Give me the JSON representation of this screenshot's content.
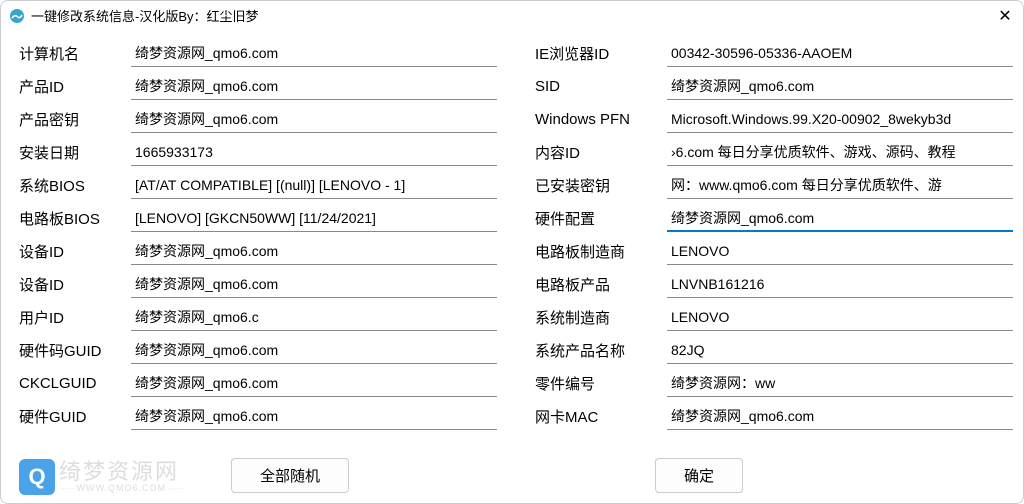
{
  "titlebar": {
    "title": "一键修改系统信息-汉化版By：红尘旧梦"
  },
  "left_fields": [
    {
      "label": "计算机名",
      "value": "绮梦资源网_qmo6.com"
    },
    {
      "label": "产品ID",
      "value": "绮梦资源网_qmo6.com"
    },
    {
      "label": "产品密钥",
      "value": "绮梦资源网_qmo6.com"
    },
    {
      "label": "安装日期",
      "value": "1665933173"
    },
    {
      "label": "系统BIOS",
      "value": "[AT/AT COMPATIBLE] [(null)] [LENOVO - 1]"
    },
    {
      "label": "电路板BIOS",
      "value": "[LENOVO] [GKCN50WW] [11/24/2021]"
    },
    {
      "label": "设备ID",
      "value": "绮梦资源网_qmo6.com"
    },
    {
      "label": "设备ID",
      "value": "绮梦资源网_qmo6.com"
    },
    {
      "label": "用户ID",
      "value": "绮梦资源网_qmo6.c"
    },
    {
      "label": "硬件码GUID",
      "value": "绮梦资源网_qmo6.com"
    },
    {
      "label": "CKCLGUID",
      "value": "绮梦资源网_qmo6.com"
    },
    {
      "label": "硬件GUID",
      "value": "绮梦资源网_qmo6.com"
    }
  ],
  "right_fields": [
    {
      "label": "IE浏览器ID",
      "value": "00342-30596-05336-AAOEM"
    },
    {
      "label": "SID",
      "value": "绮梦资源网_qmo6.com"
    },
    {
      "label": "Windows PFN",
      "value": "Microsoft.Windows.99.X20-00902_8wekyb3d"
    },
    {
      "label": "内容ID",
      "value": "›6.com 每日分享优质软件、游戏、源码、教程"
    },
    {
      "label": "已安装密钥",
      "value": "网：www.qmo6.com 每日分享优质软件、游"
    },
    {
      "label": "硬件配置",
      "value": "绮梦资源网_qmo6.com",
      "focused": true
    },
    {
      "label": "电路板制造商",
      "value": "LENOVO"
    },
    {
      "label": "电路板产品",
      "value": "LNVNB161216"
    },
    {
      "label": "系统制造商",
      "value": "LENOVO"
    },
    {
      "label": "系统产品名称",
      "value": "82JQ"
    },
    {
      "label": "零件编号",
      "value": "绮梦资源网：ww"
    },
    {
      "label": "网卡MAC",
      "value": "绮梦资源网_qmo6.com"
    }
  ],
  "buttons": {
    "randomize": "全部随机",
    "confirm": "确定"
  },
  "watermark": {
    "logo_letter": "Q",
    "main": "绮梦资源网",
    "sub": " WWW.QMO6.COM "
  }
}
